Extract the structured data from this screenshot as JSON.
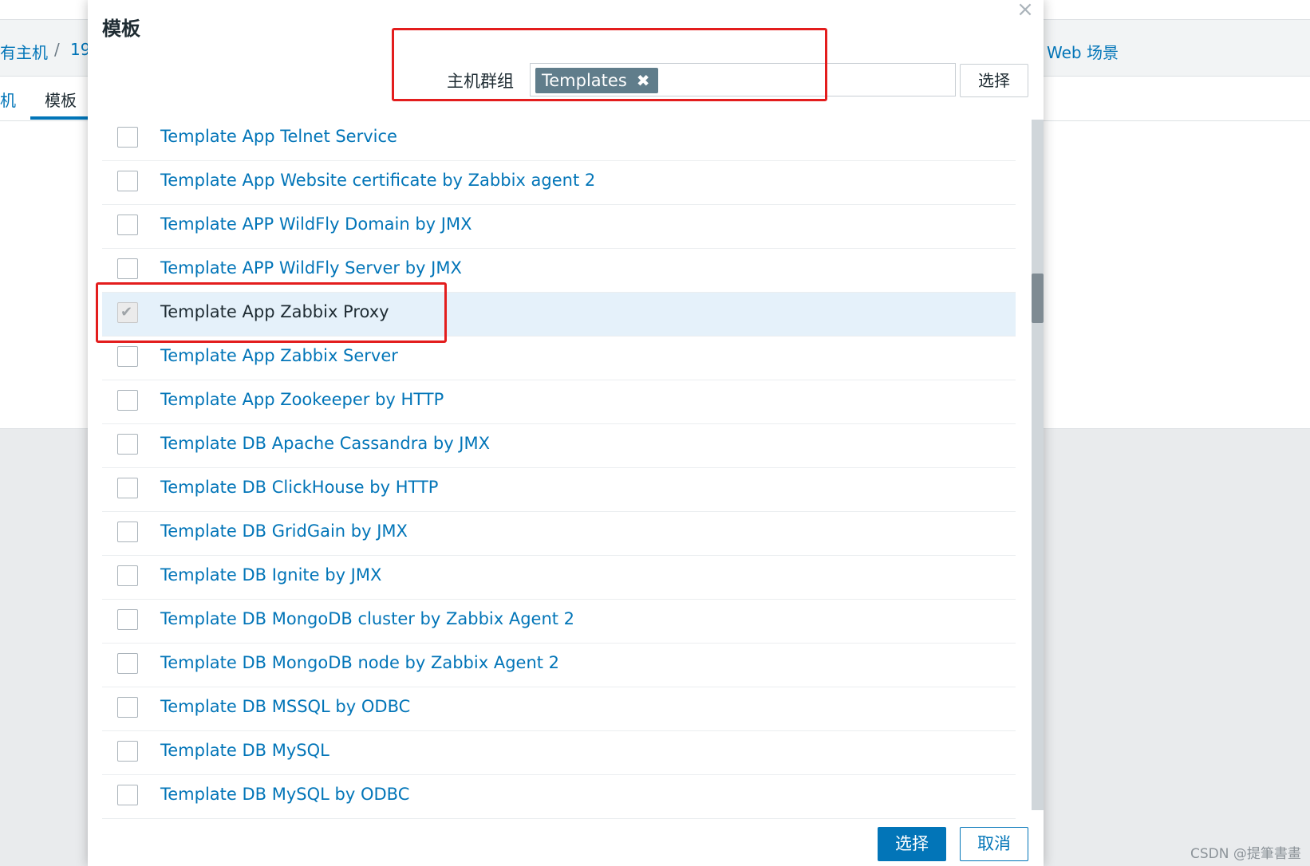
{
  "background": {
    "breadcrumbs": [
      "有主机",
      "/",
      "19"
    ],
    "right_crumb": "Web 场景",
    "tabs": [
      "机",
      "模板"
    ]
  },
  "dialog": {
    "title": "模板",
    "close_icon": "×",
    "filter": {
      "label": "主机群组",
      "tags": [
        "Templates"
      ],
      "tag_remove_icon": "✖",
      "select_button": "选择"
    },
    "items": [
      {
        "label": "Template App Telnet Service",
        "checked": false
      },
      {
        "label": "Template App Website certificate by Zabbix agent 2",
        "checked": false
      },
      {
        "label": "Template APP WildFly Domain by JMX",
        "checked": false
      },
      {
        "label": "Template APP WildFly Server by JMX",
        "checked": false
      },
      {
        "label": "Template App Zabbix Proxy",
        "checked": true
      },
      {
        "label": "Template App Zabbix Server",
        "checked": false
      },
      {
        "label": "Template App Zookeeper by HTTP",
        "checked": false
      },
      {
        "label": "Template DB Apache Cassandra by JMX",
        "checked": false
      },
      {
        "label": "Template DB ClickHouse by HTTP",
        "checked": false
      },
      {
        "label": "Template DB GridGain by JMX",
        "checked": false
      },
      {
        "label": "Template DB Ignite by JMX",
        "checked": false
      },
      {
        "label": "Template DB MongoDB cluster by Zabbix Agent 2",
        "checked": false
      },
      {
        "label": "Template DB MongoDB node by Zabbix Agent 2",
        "checked": false
      },
      {
        "label": "Template DB MSSQL by ODBC",
        "checked": false
      },
      {
        "label": "Template DB MySQL",
        "checked": false
      },
      {
        "label": "Template DB MySQL by ODBC",
        "checked": false
      }
    ],
    "footer": {
      "select_button": "选择",
      "cancel_button": "取消"
    }
  },
  "watermark": "CSDN @提筆書畫",
  "colors": {
    "link": "#0275b8",
    "highlight": "#e31d1d",
    "selected_row": "#e5f1fa",
    "tag": "#607d8b"
  }
}
